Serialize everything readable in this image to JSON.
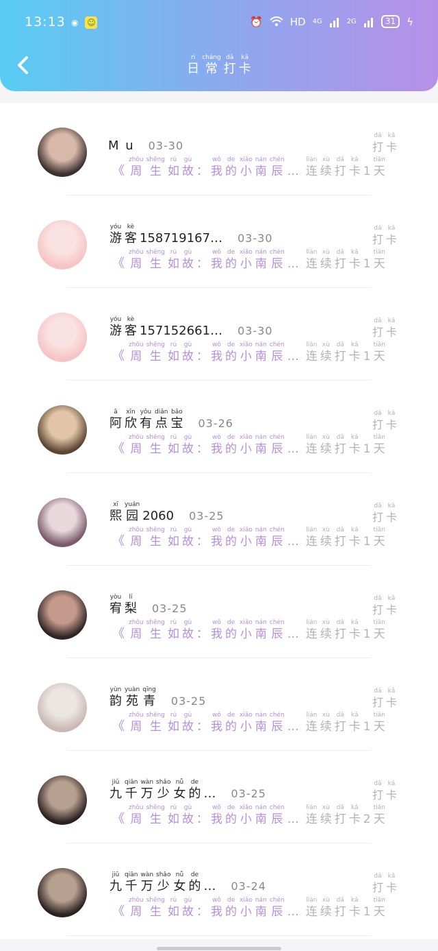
{
  "status_bar": {
    "time": "13:13",
    "network": "HD",
    "signal1": "4G",
    "signal2": "2G",
    "battery": "31"
  },
  "header": {
    "title": [
      {
        "ch": "日",
        "py": "rì"
      },
      {
        "ch": "常",
        "py": "cháng"
      },
      {
        "ch": "打",
        "py": "dǎ"
      },
      {
        "ch": "卡",
        "py": "kǎ"
      }
    ]
  },
  "labels": {
    "checkin": [
      {
        "ch": "打",
        "py": "dǎ"
      },
      {
        "ch": "卡",
        "py": "kǎ"
      }
    ],
    "book_mark": "《",
    "book_title": [
      {
        "ch": "周",
        "py": "zhōu"
      },
      {
        "ch": "生",
        "py": "shēng"
      },
      {
        "ch": "如",
        "py": "rú"
      },
      {
        "ch": "故",
        "py": "gù"
      },
      {
        "ch": "：",
        "py": ""
      },
      {
        "ch": "我",
        "py": "wǒ"
      },
      {
        "ch": "的",
        "py": "de"
      },
      {
        "ch": "小",
        "py": "xiǎo"
      },
      {
        "ch": "南",
        "py": "nán"
      },
      {
        "ch": "辰",
        "py": "chén"
      },
      {
        "ch": "…",
        "py": ""
      }
    ],
    "streak_prefix": [
      {
        "ch": "连",
        "py": "lián"
      },
      {
        "ch": "续",
        "py": "xù"
      },
      {
        "ch": "打",
        "py": "dǎ"
      },
      {
        "ch": "卡",
        "py": "kǎ"
      }
    ],
    "streak_suffix": {
      "ch": "天",
      "py": "tiān"
    }
  },
  "entries": [
    {
      "name_plain": "Mu",
      "name": [],
      "date": "03-30",
      "days": "1",
      "avatar_colors": [
        "#3b3030",
        "#d8b8a8"
      ]
    },
    {
      "name_plain": "",
      "name": [
        {
          "ch": "游",
          "py": "yóu"
        },
        {
          "ch": "客",
          "py": "kè"
        },
        {
          "ch": "158719167…",
          "py": ""
        }
      ],
      "date": "03-30",
      "days": "1",
      "avatar_colors": [
        "#f6c4c4",
        "#fbe2e2"
      ]
    },
    {
      "name_plain": "",
      "name": [
        {
          "ch": "游",
          "py": "yóu"
        },
        {
          "ch": "客",
          "py": "kè"
        },
        {
          "ch": "157152661…",
          "py": ""
        }
      ],
      "date": "03-30",
      "days": "1",
      "avatar_colors": [
        "#f6c4c4",
        "#fbe2e2"
      ]
    },
    {
      "name_plain": "",
      "name": [
        {
          "ch": "阿",
          "py": "ā"
        },
        {
          "ch": "欣",
          "py": "xīn"
        },
        {
          "ch": "有",
          "py": "yǒu"
        },
        {
          "ch": "点",
          "py": "diǎn"
        },
        {
          "ch": "宝",
          "py": "bǎo"
        }
      ],
      "date": "03-26",
      "days": "1",
      "avatar_colors": [
        "#5b4632",
        "#e2c5a8"
      ]
    },
    {
      "name_plain": "",
      "name": [
        {
          "ch": "熙",
          "py": "xī"
        },
        {
          "ch": "园",
          "py": "yuán"
        },
        {
          "ch": "2060",
          "py": ""
        }
      ],
      "date": "03-25",
      "days": "1",
      "avatar_colors": [
        "#7a5a6a",
        "#e8d8dc"
      ]
    },
    {
      "name_plain": "",
      "name": [
        {
          "ch": "宥",
          "py": "yòu"
        },
        {
          "ch": "梨",
          "py": "lí"
        }
      ],
      "date": "03-25",
      "days": "1",
      "avatar_colors": [
        "#2e2424",
        "#c49a8c"
      ]
    },
    {
      "name_plain": "",
      "name": [
        {
          "ch": "韵",
          "py": "yùn"
        },
        {
          "ch": "苑",
          "py": "yuàn"
        },
        {
          "ch": "青",
          "py": "qīng"
        }
      ],
      "date": "03-25",
      "days": "1",
      "avatar_colors": [
        "#c9b9b5",
        "#ece6e3"
      ]
    },
    {
      "name_plain": "",
      "name": [
        {
          "ch": "九",
          "py": "jiǔ"
        },
        {
          "ch": "千",
          "py": "qiān"
        },
        {
          "ch": "万",
          "py": "wàn"
        },
        {
          "ch": "少",
          "py": "shǎo"
        },
        {
          "ch": "女",
          "py": "nǚ"
        },
        {
          "ch": "的",
          "py": "de"
        },
        {
          "ch": "…",
          "py": ""
        }
      ],
      "date": "03-25",
      "days": "2",
      "avatar_colors": [
        "#2b2220",
        "#b8a090"
      ]
    },
    {
      "name_plain": "",
      "name": [
        {
          "ch": "九",
          "py": "jiǔ"
        },
        {
          "ch": "千",
          "py": "qiān"
        },
        {
          "ch": "万",
          "py": "wàn"
        },
        {
          "ch": "少",
          "py": "shǎo"
        },
        {
          "ch": "女",
          "py": "nǚ"
        },
        {
          "ch": "的",
          "py": "de"
        },
        {
          "ch": "…",
          "py": ""
        }
      ],
      "date": "03-24",
      "days": "1",
      "avatar_colors": [
        "#2b2220",
        "#b8a090"
      ]
    }
  ]
}
